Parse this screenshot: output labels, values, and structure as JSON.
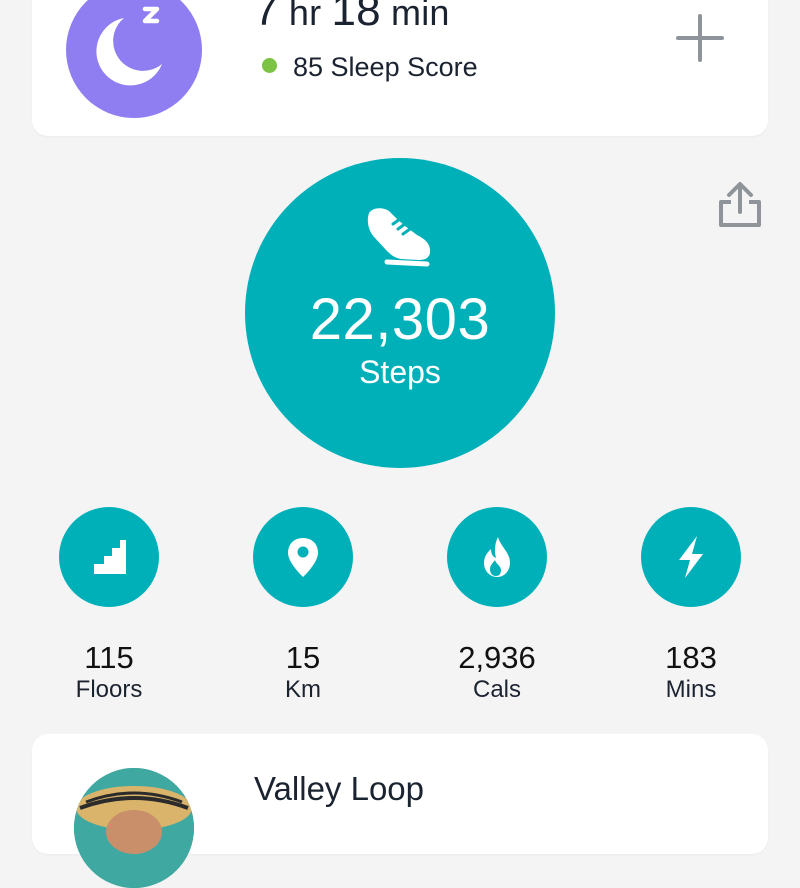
{
  "sleep": {
    "hours": "7",
    "hr_unit": "hr",
    "minutes": "18",
    "min_unit": "min",
    "score_text": "85 Sleep Score",
    "icon": "moon-sleep-icon",
    "score_color": "#7cc243",
    "avatar_color": "#8f7ef2"
  },
  "add_icon": "plus-icon",
  "share_icon": "share-icon",
  "steps": {
    "value": "22,303",
    "label": "Steps",
    "icon": "shoe-icon",
    "color": "#00b0b9"
  },
  "stats": [
    {
      "value": "115",
      "label": "Floors",
      "icon": "stairs-icon"
    },
    {
      "value": "15",
      "label": "Km",
      "icon": "location-pin-icon"
    },
    {
      "value": "2,936",
      "label": "Cals",
      "icon": "flame-icon"
    },
    {
      "value": "183",
      "label": "Mins",
      "icon": "lightning-icon"
    }
  ],
  "activity": {
    "title": "Valley Loop"
  }
}
